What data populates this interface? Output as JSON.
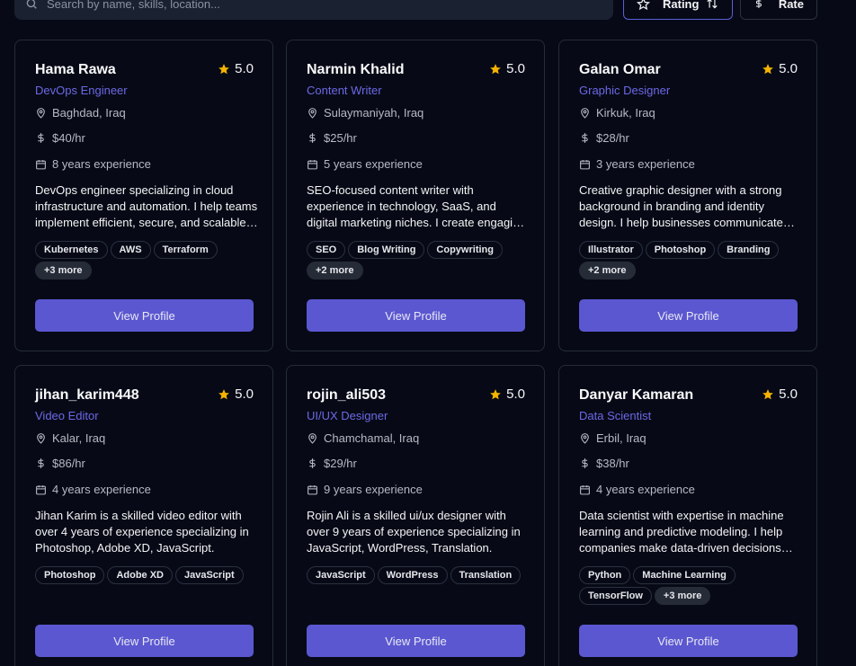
{
  "search": {
    "placeholder": "Search by name, skills, location..."
  },
  "sort": {
    "rating_label": "Rating",
    "rate_label": "Rate"
  },
  "colors": {
    "accent": "#5b57d0",
    "star": "#f5b400",
    "role": "#6d68e6"
  },
  "cards": [
    {
      "name": "Hama Rawa",
      "rating": "5.0",
      "role": "DevOps Engineer",
      "location": "Baghdad, Iraq",
      "rate": "$40/hr",
      "experience": "8 years experience",
      "description": "DevOps engineer specializing in cloud infrastructure and automation. I help teams implement efficient, secure, and scalable infrastructure solutions.",
      "tags": [
        "Kubernetes",
        "AWS",
        "Terraform"
      ],
      "more": "+3 more",
      "button": "View Profile"
    },
    {
      "name": "Narmin Khalid",
      "rating": "5.0",
      "role": "Content Writer",
      "location": "Sulaymaniyah, Iraq",
      "rate": "$25/hr",
      "experience": "5 years experience",
      "description": "SEO-focused content writer with experience in technology, SaaS, and digital marketing niches. I create engaging content that ranks.",
      "tags": [
        "SEO",
        "Blog Writing",
        "Copywriting"
      ],
      "more": "+2 more",
      "button": "View Profile"
    },
    {
      "name": "Galan Omar",
      "rating": "5.0",
      "role": "Graphic Designer",
      "location": "Kirkuk, Iraq",
      "rate": "$28/hr",
      "experience": "3 years experience",
      "description": "Creative graphic designer with a strong background in branding and identity design. I help businesses communicate their brand visually.",
      "tags": [
        "Illustrator",
        "Photoshop",
        "Branding"
      ],
      "more": "+2 more",
      "button": "View Profile"
    },
    {
      "name": "jihan_karim448",
      "rating": "5.0",
      "role": "Video Editor",
      "location": "Kalar, Iraq",
      "rate": "$86/hr",
      "experience": "4 years experience",
      "description": "Jihan Karim is a skilled video editor with over 4 years of experience specializing in Photoshop, Adobe XD, JavaScript.",
      "tags": [
        "Photoshop",
        "Adobe XD",
        "JavaScript"
      ],
      "more": "",
      "button": "View Profile"
    },
    {
      "name": "rojin_ali503",
      "rating": "5.0",
      "role": "UI/UX Designer",
      "location": "Chamchamal, Iraq",
      "rate": "$29/hr",
      "experience": "9 years experience",
      "description": "Rojin Ali is a skilled ui/ux designer with over 9 years of experience specializing in JavaScript, WordPress, Translation.",
      "tags": [
        "JavaScript",
        "WordPress",
        "Translation"
      ],
      "more": "",
      "button": "View Profile"
    },
    {
      "name": "Danyar Kamaran",
      "rating": "5.0",
      "role": "Data Scientist",
      "location": "Erbil, Iraq",
      "rate": "$38/hr",
      "experience": "4 years experience",
      "description": "Data scientist with expertise in machine learning and predictive modeling. I help companies make data-driven decisions with confidence.",
      "tags": [
        "Python",
        "Machine Learning",
        "TensorFlow"
      ],
      "more": "+3 more",
      "button": "View Profile"
    }
  ]
}
